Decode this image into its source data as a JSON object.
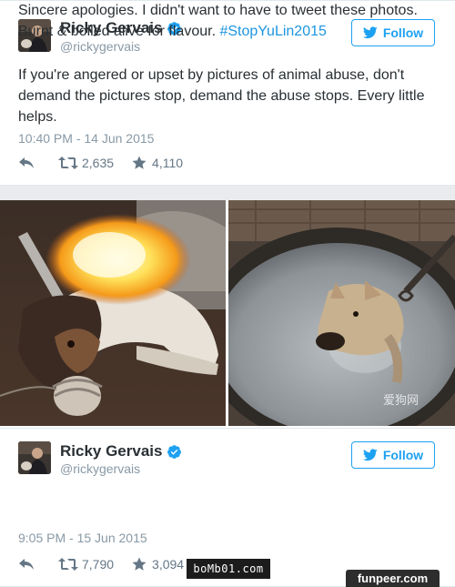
{
  "tweets": [
    {
      "name": "Ricky Gervais",
      "handle": "@rickygervais",
      "follow_label": "Follow",
      "text": "If you're angered or upset by pictures of animal abuse, don't demand the pictures stop, demand the abuse stops. Every little helps.",
      "timestamp": "10:40 PM - 14 Jun 2015",
      "retweets": "2,635",
      "likes": "4,110"
    },
    {
      "name": "Ricky Gervais",
      "handle": "@rickygervais",
      "follow_label": "Follow",
      "text_plain": "Sincere apologies. I didn't want to have to tweet these photos. Burnt & boiled alive for flavour. ",
      "hashtag": "#StopYuLin2015",
      "timestamp": "9:05 PM - 15 Jun 2015",
      "retweets": "7,790",
      "likes": "3,094"
    }
  ],
  "photo_watermark": "爱狗网",
  "overlay_watermark": "boMb01.com",
  "site_watermark": "funpeer.com",
  "colors": {
    "accent": "#1da1f2",
    "hashtag": "#1b95e0",
    "muted": "#8899a6"
  },
  "icons": [
    "verified-badge-icon",
    "twitter-bird-icon",
    "reply-icon",
    "retweet-icon",
    "like-star-icon"
  ]
}
